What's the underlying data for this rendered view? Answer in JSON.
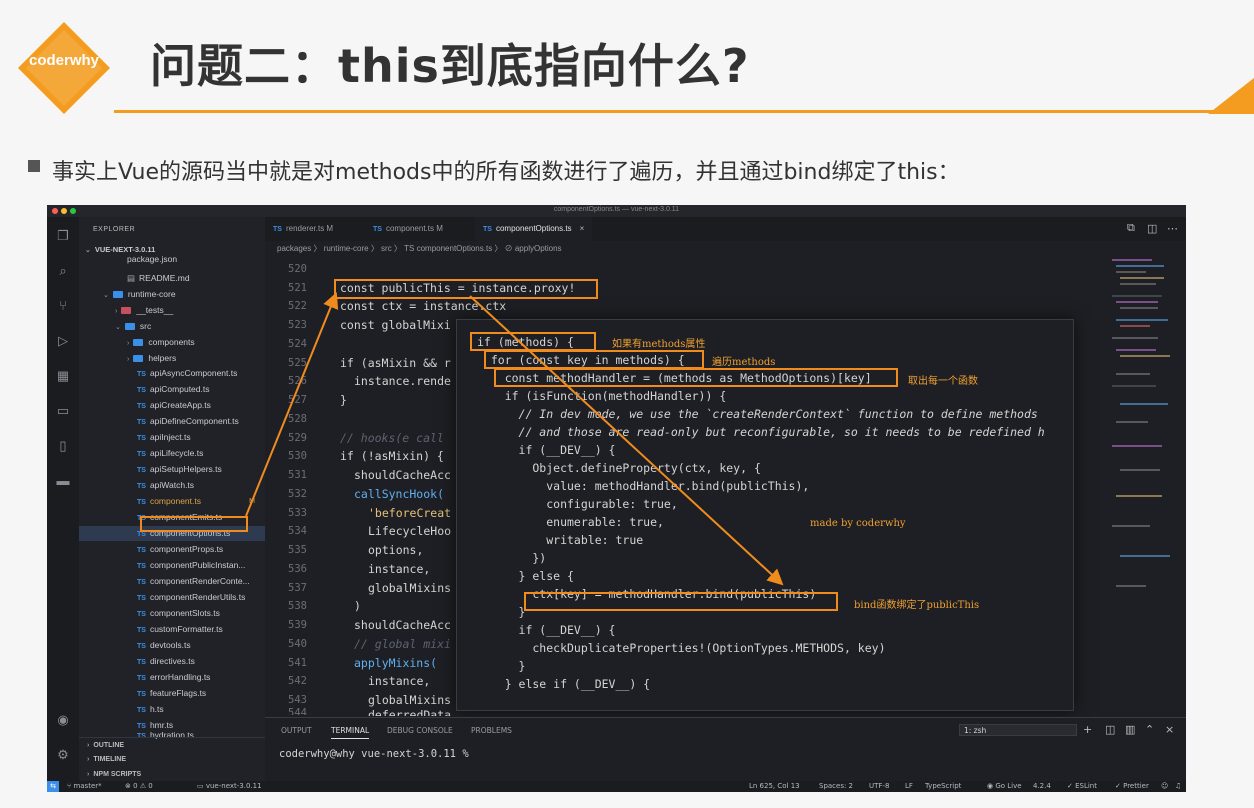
{
  "slide": {
    "logo_text": "coderwhy",
    "title": "问题二：this到底指向什么?",
    "bullet": "事实上Vue的源码当中就是对methods中的所有函数进行了遍历，并且通过bind绑定了this："
  },
  "window": {
    "title": "componentOptions.ts — vue-next-3.0.11"
  },
  "sidebar": {
    "header": "EXPLORER",
    "root": "VUE-NEXT-3.0.11",
    "items": [
      "package.json",
      "README.md",
      "runtime-core",
      "__tests__",
      "src",
      "components",
      "helpers",
      "apiAsyncComponent.ts",
      "apiComputed.ts",
      "apiCreateApp.ts",
      "apiDefineComponent.ts",
      "apiInject.ts",
      "apiLifecycle.ts",
      "apiSetupHelpers.ts",
      "apiWatch.ts",
      "component.ts",
      "componentEmits.ts",
      "componentOptions.ts",
      "componentProps.ts",
      "componentPublicInstan...",
      "componentRenderConte...",
      "componentRenderUtils.ts",
      "componentSlots.ts",
      "customFormatter.ts",
      "devtools.ts",
      "directives.ts",
      "errorHandling.ts",
      "featureFlags.ts",
      "h.ts",
      "hmr.ts",
      "hydration.ts"
    ],
    "modified_badge": "M",
    "ts_badge": "TS",
    "sections": [
      "OUTLINE",
      "TIMELINE",
      "NPM SCRIPTS"
    ]
  },
  "tabs": [
    "renderer.ts M",
    "component.ts M",
    "componentOptions.ts"
  ],
  "breadcrumb": "packages 〉 runtime-core 〉 src 〉 TS componentOptions.ts 〉 ⊘ applyOptions",
  "line_numbers": [
    "520",
    "521",
    "522",
    "523",
    "524",
    "525",
    "526",
    "527",
    "528",
    "529",
    "530",
    "531",
    "532",
    "533",
    "534",
    "535",
    "536",
    "537",
    "538",
    "539",
    "540",
    "541",
    "542",
    "543",
    "544"
  ],
  "code": {
    "l521": "const publicThis = instance.proxy!",
    "l522": "const ctx = instance.ctx",
    "l523": "const globalMixi",
    "l525": "if (asMixin && r",
    "l526": "instance.rende",
    "l527": "}",
    "l529": "// hooks(e call",
    "l530": "if (!asMixin) {",
    "l531": "shouldCacheAcc",
    "l532": "callSyncHook(",
    "l533": "'beforeCreat",
    "l534": "LifecycleHoo",
    "l535": "options,",
    "l536": "instance,",
    "l537": "globalMixins",
    "l538": ")",
    "l539": "shouldCacheAcc",
    "l540": "// global mixi",
    "l541": "applyMixins(",
    "l542": "instance,",
    "l543": "globalMixins",
    "l544": "deferredData"
  },
  "popup": {
    "lines": [
      "if (methods) {",
      "  for (const key in methods) {",
      "    const methodHandler = (methods as MethodOptions)[key]",
      "    if (isFunction(methodHandler)) {",
      "      // In dev mode, we use the `createRenderContext` function to define methods",
      "      // and those are read-only but reconfigurable, so it needs to be redefined h",
      "      if (__DEV__) {",
      "        Object.defineProperty(ctx, key, {",
      "          value: methodHandler.bind(publicThis),",
      "          configurable: true,",
      "          enumerable: true,",
      "          writable: true",
      "        })",
      "      } else {",
      "        ctx[key] = methodHandler.bind(publicThis)",
      "      }",
      "      if (__DEV__) {",
      "        checkDuplicateProperties!(OptionTypes.METHODS, key)",
      "      }",
      "    } else if (__DEV__) {"
    ]
  },
  "annotations": {
    "a1": "如果有methods属性",
    "a2": "遍历methods",
    "a3": "取出每一个函数",
    "a4": "made by coderwhy",
    "a5": "bind函数绑定了publicThis"
  },
  "panel": {
    "tabs": [
      "OUTPUT",
      "TERMINAL",
      "DEBUG CONSOLE",
      "PROBLEMS"
    ],
    "terminal_select": "1: zsh",
    "terminal_line": "coderwhy@why vue-next-3.0.11 %"
  },
  "statusbar": {
    "branch": "master*",
    "problems": "⊗ 0 ⚠ 0",
    "folder": "vue-next-3.0.11",
    "position": "Ln 625, Col 13",
    "spaces": "Spaces: 2",
    "encoding": "UTF-8",
    "eol": "LF",
    "language": "TypeScript",
    "golive": "Go Live",
    "version": "4.2.4",
    "eslint": "ESLint",
    "prettier": "Prettier"
  },
  "colors": {
    "accent": "#f39c1f",
    "annotation": "#f08c1e",
    "editor_bg": "#1e1f24"
  }
}
